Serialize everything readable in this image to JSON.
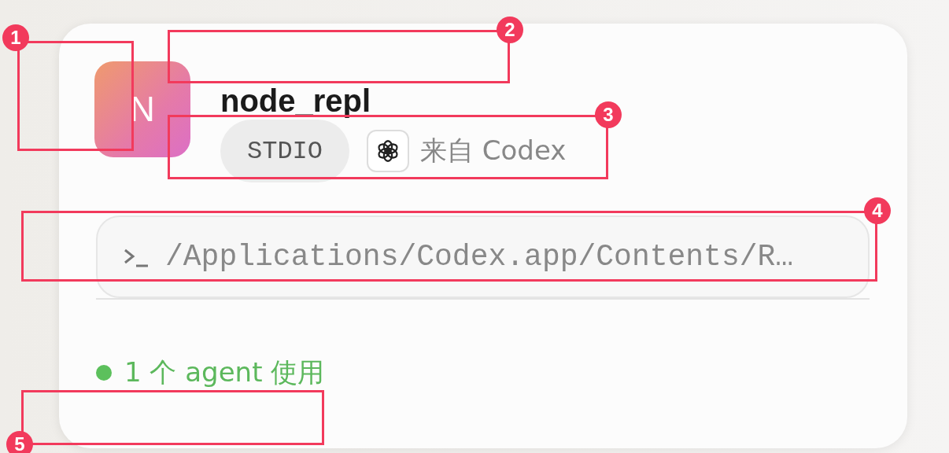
{
  "server": {
    "avatar_letter": "N",
    "name": "node_repl",
    "transport": "STDIO",
    "source": "来自 Codex",
    "command": "/Applications/Codex.app/Contents/R…",
    "status": {
      "text": "1 个 agent 使用",
      "active": true
    }
  },
  "annotations": [
    {
      "label": "1"
    },
    {
      "label": "2"
    },
    {
      "label": "3"
    },
    {
      "label": "4"
    },
    {
      "label": "5"
    }
  ]
}
